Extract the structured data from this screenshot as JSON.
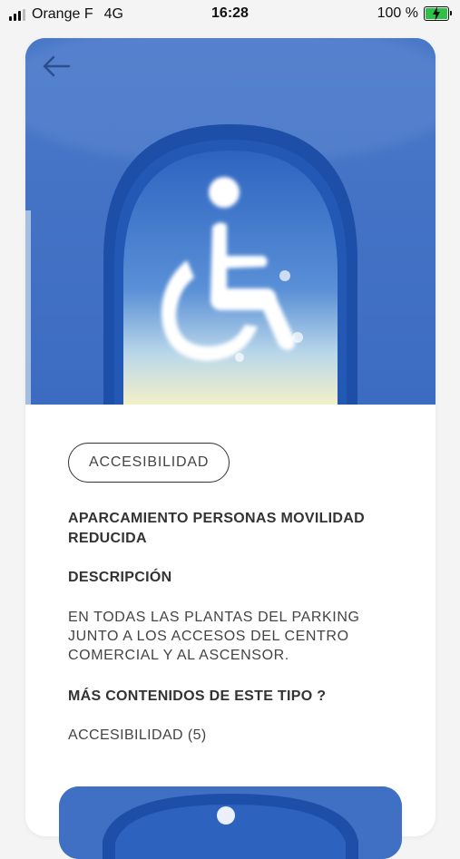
{
  "status_bar": {
    "carrier": "Orange F",
    "network": "4G",
    "time": "16:28",
    "battery_percent": "100 %",
    "battery_level": 1.0,
    "battery_color": "#2fc04a"
  },
  "hero": {
    "image": "wheelchair-accessibility-cloud-arch",
    "back_icon": "arrow-left-icon"
  },
  "detail": {
    "tag": "ACCESIBILIDAD",
    "title": "APARCAMIENTO PERSONAS MOVILIDAD REDUCIDA",
    "description_heading": "DESCRIPCIÓN",
    "description": "EN TODAS LAS PLANTAS DEL PARKING JUNTO A LOS ACCESOS DEL CENTRO COMERCIAL Y AL ASCENSOR.",
    "more_heading": "MÁS CONTENIDOS DE ESTE TIPO ?",
    "related_link": "ACCESIBILIDAD (5)"
  },
  "colors": {
    "hero_blue": "#3f70c4",
    "text": "#333333",
    "background": "#f4f4f4"
  }
}
